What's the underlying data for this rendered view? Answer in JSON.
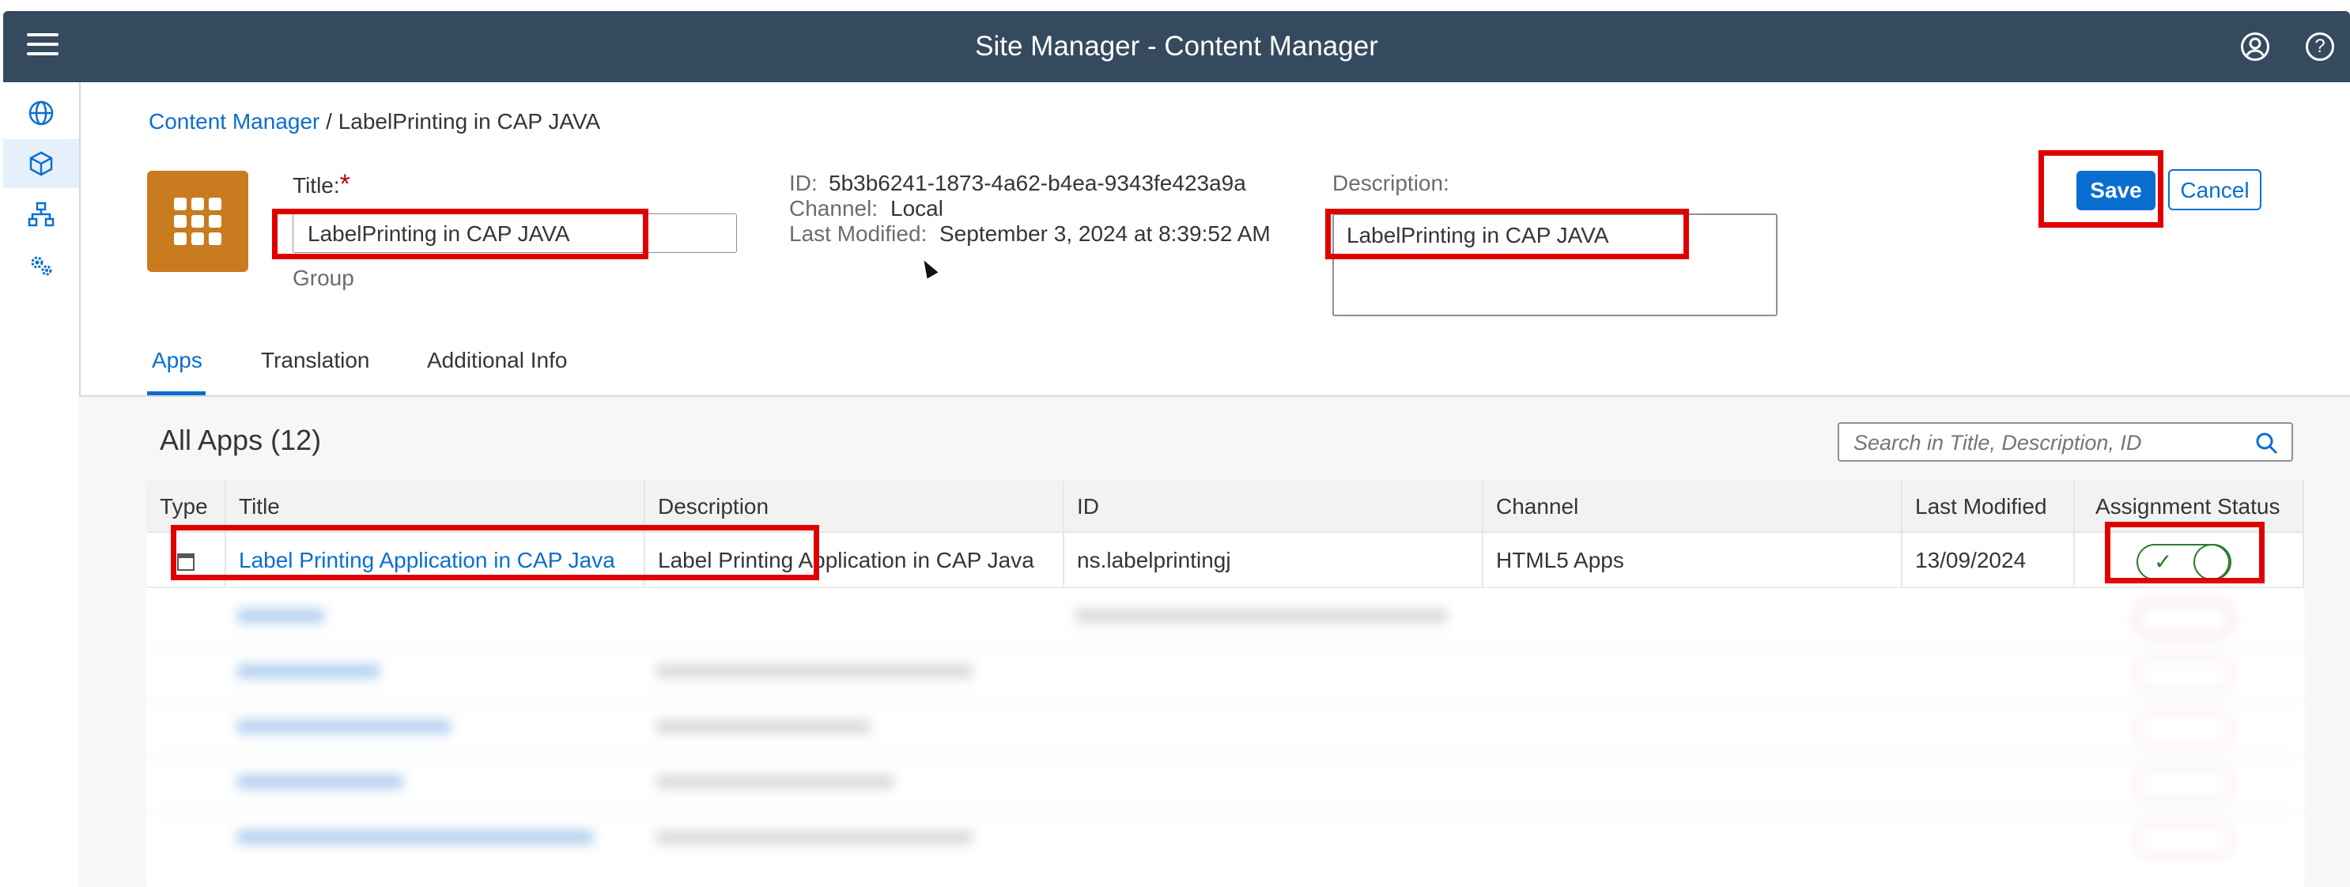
{
  "header": {
    "title": "Site Manager - Content Manager",
    "menu_icon": "hamburger-menu-icon",
    "user_icon": "user-profile-icon",
    "help_icon": "help-icon"
  },
  "leftnav": {
    "items": [
      "globe-icon",
      "cube-icon",
      "sitemap-icon",
      "settings-gears-icon"
    ],
    "active_index": 1
  },
  "breadcrumb": {
    "root": "Content Manager",
    "separator": "/",
    "current": "LabelPrinting in CAP JAVA"
  },
  "group": {
    "tile_icon": "app-grid-icon",
    "title_label": "Title:",
    "required_mark": "*",
    "title_value": "LabelPrinting in CAP JAVA",
    "type_label": "Group",
    "id_label": "ID:",
    "id_value": "5b3b6241-1873-4a62-b4ea-9343fe423a9a",
    "channel_label": "Channel:",
    "channel_value": "Local",
    "modified_label": "Last Modified:",
    "modified_value": "September 3, 2024 at 8:39:52 AM",
    "description_label": "Description:",
    "description_value": "LabelPrinting in CAP JAVA"
  },
  "actions": {
    "save": "Save",
    "cancel": "Cancel"
  },
  "tabs": [
    "Apps",
    "Translation",
    "Additional Info"
  ],
  "apps": {
    "title": "All Apps (12)",
    "search_placeholder": "Search in Title, Description, ID",
    "columns": [
      "Type",
      "Title",
      "Description",
      "ID",
      "Channel",
      "Last Modified",
      "Assignment Status"
    ],
    "rows": [
      {
        "title": "Label Printing Application in CAP Java",
        "description": "Label Printing Application in CAP Java",
        "id": "ns.labelprintingj",
        "channel": "HTML5 Apps",
        "modified": "13/09/2024",
        "assigned": true
      }
    ]
  },
  "colors": {
    "shell": "#354a5f",
    "accent": "#0a6ed1",
    "tile": "#c87b1f",
    "highlight": "#e00000",
    "toggle_on": "#2b7c2b"
  }
}
